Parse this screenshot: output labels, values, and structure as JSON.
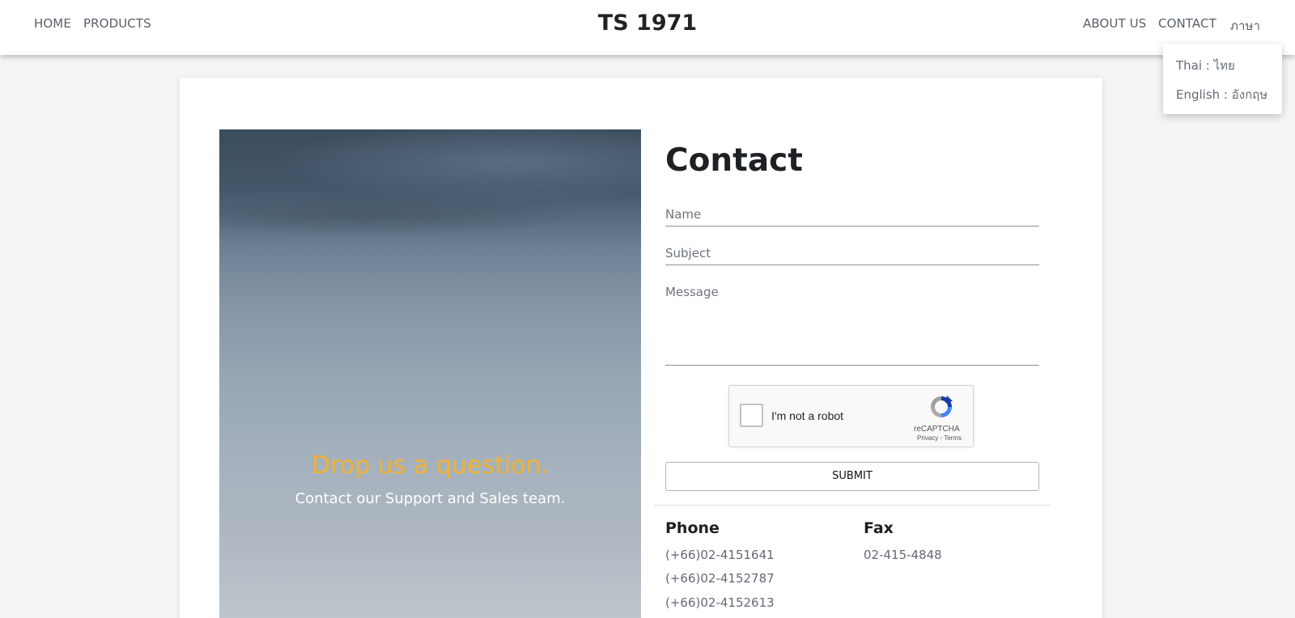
{
  "nav": {
    "brand": "TS 1971",
    "home": "HOME",
    "products": "PRODUCTS",
    "about": "ABOUT US",
    "contact": "CONTACT",
    "language": "ภาษา"
  },
  "language_menu": {
    "items": [
      "Thai : ไทย",
      "English : อังกฤษ"
    ]
  },
  "hero": {
    "title": "Drop us a question.",
    "subtitle": "Contact our Support and Sales team."
  },
  "form": {
    "title": "Contact",
    "name_label": "Name",
    "subject_label": "Subject",
    "message_label": "Message",
    "submit_label": "SUBMIT"
  },
  "captcha": {
    "label": "I'm not a robot",
    "brand": "reCAPTCHA",
    "links": "Privacy - Terms",
    "checked": false
  },
  "info": {
    "phone_heading": "Phone",
    "phones": [
      "(+66)02-4151641",
      "(+66)02-4152787",
      "(+66)02-4152613"
    ],
    "fax_heading": "Fax",
    "fax": "02-415-4848"
  },
  "colors": {
    "accent": "#f2b233",
    "text_dark": "#1d2124",
    "text_muted": "#636a72"
  }
}
